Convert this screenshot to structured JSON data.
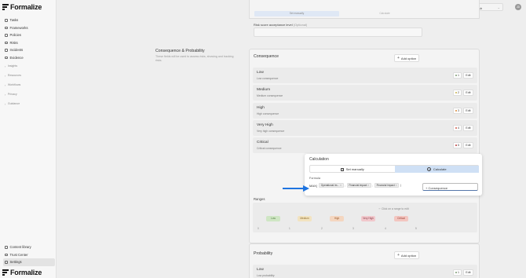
{
  "app": {
    "name": "Formalize"
  },
  "sidebar": {
    "items": [
      {
        "label": "Tasks",
        "icon": "check-square-icon"
      },
      {
        "label": "Frameworks",
        "icon": "grid-icon"
      },
      {
        "label": "Policies",
        "icon": "document-icon"
      },
      {
        "label": "Risks",
        "icon": "warning-icon"
      },
      {
        "label": "Incidents",
        "icon": "alert-icon"
      },
      {
        "label": "Evidence",
        "icon": "folder-icon"
      }
    ],
    "groups": [
      {
        "label": "Insights"
      },
      {
        "label": "Resources"
      },
      {
        "label": "Workflows"
      },
      {
        "label": "Privacy"
      },
      {
        "label": "Guidance"
      }
    ],
    "bottom_items": [
      {
        "label": "Content library",
        "icon": "book-icon"
      },
      {
        "label": "Trust Center",
        "icon": "shield-icon"
      },
      {
        "label": "Settings",
        "icon": "gear-icon",
        "active": true
      }
    ]
  },
  "topbar": {
    "language": "English",
    "avatar_initials": "JD"
  },
  "risk_acceptance": {
    "tab_manual": "Set manually",
    "tab_calculate": "Calculate",
    "label": "Risk score acceptance level",
    "optional": "(Optional)"
  },
  "section": {
    "title": "Consequence & Probability",
    "description": "These fields will be used to assess risks, showing and tracking risks."
  },
  "consequence": {
    "title": "Consequence",
    "add_option": "Add option",
    "edit_label": "Edit",
    "rows": [
      {
        "name": "Low",
        "description": "Low consequence",
        "score": "1",
        "color": "#7a9a70"
      },
      {
        "name": "Medium",
        "description": "Medium consequence",
        "score": "2",
        "color": "#c7b04a"
      },
      {
        "name": "High",
        "description": "High consequence",
        "score": "3",
        "color": "#d88a3a"
      },
      {
        "name": "Very High",
        "description": "Very high consequence",
        "score": "4",
        "color": "#d25c4a"
      },
      {
        "name": "Critical",
        "description": "Critical consequence",
        "score": "5",
        "color": "#b83a3a"
      }
    ]
  },
  "calculation_modal": {
    "title": "Calculation",
    "set_manually": "Set manually",
    "calculate": "Calculate",
    "formula_label": "Formula",
    "formula_fn": "MAX(",
    "tokens": [
      "Operational im...",
      "Financial impact",
      "Financial impact"
    ],
    "add_consequence": "+ Consequence"
  },
  "ranges": {
    "label": "Ranges",
    "hint": "Click on a range to edit",
    "chips": [
      {
        "label": "Low",
        "bg": "#cfe6c4",
        "fg": "#4d7a3d"
      },
      {
        "label": "Medium",
        "bg": "#f2e3c0",
        "fg": "#8a6a2a"
      },
      {
        "label": "High",
        "bg": "#f4d6c0",
        "fg": "#9a5a2a"
      },
      {
        "label": "Very High",
        "bg": "#f1c8cc",
        "fg": "#8a3a44"
      },
      {
        "label": "Critical",
        "bg": "#f3c6c0",
        "fg": "#9a3a30"
      }
    ],
    "ticks": [
      "0",
      "1",
      "2",
      "3",
      "4",
      "5"
    ]
  },
  "probability": {
    "title": "Probability",
    "add_option": "Add option",
    "edit_label": "Edit",
    "rows": [
      {
        "name": "Low",
        "description": "Low probability",
        "score": "1",
        "color": "#7a9a70"
      }
    ]
  },
  "annotation": {
    "arrow_color": "#1e74e0"
  }
}
